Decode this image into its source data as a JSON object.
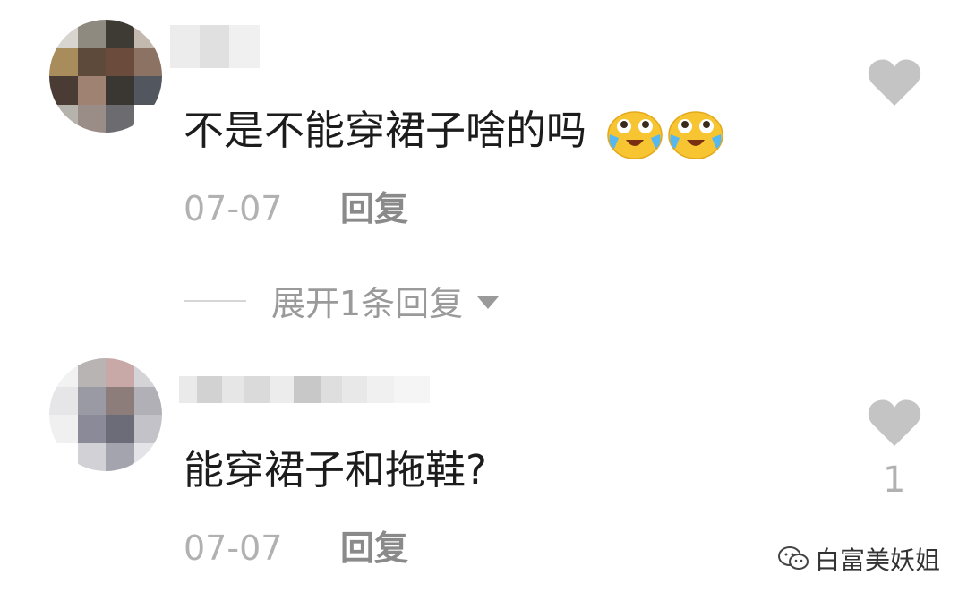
{
  "comments": [
    {
      "text": "不是不能穿裙子啥的吗",
      "emojis": [
        "crying-laugh-emoji",
        "crying-laugh-emoji"
      ],
      "date": "07-07",
      "reply_label": "回复",
      "like_count": ""
    },
    {
      "text": "能穿裙子和拖鞋?",
      "date": "07-07",
      "reply_label": "回复",
      "like_count": "1"
    }
  ],
  "expand_replies_label": "展开1条回复",
  "watermark": {
    "text": "白富美妖姐",
    "icon": "wechat-icon"
  },
  "colors": {
    "text": "#1c1c1c",
    "muted": "#b1b1b1",
    "reply": "#8a8a8a",
    "heart": "#c4c4c4"
  }
}
